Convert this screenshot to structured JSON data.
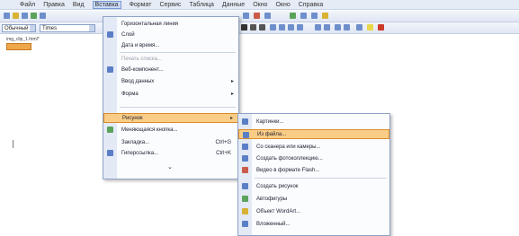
{
  "menubar": {
    "items": [
      {
        "label": "Файл",
        "active": false
      },
      {
        "label": "Правка",
        "active": false
      },
      {
        "label": "Вид",
        "active": false
      },
      {
        "label": "Вставка",
        "active": true
      },
      {
        "label": "Формат",
        "active": false
      },
      {
        "label": "Сервис",
        "active": false
      },
      {
        "label": "Таблица",
        "active": false
      },
      {
        "label": "Данные",
        "active": false
      },
      {
        "label": "Окно",
        "active": false
      },
      {
        "label": "Окно",
        "active": false
      },
      {
        "label": "Справка",
        "active": false
      }
    ]
  },
  "toolbar2": {
    "style_value": "Обычный",
    "font_value": "Times"
  },
  "document": {
    "filename": "img_clip_1.html*"
  },
  "insert_menu": {
    "items": [
      {
        "label": "Горизонтальная линия"
      },
      {
        "label": "Слой"
      },
      {
        "label": "Дата и время..."
      },
      {
        "label": "Печать списка..."
      },
      {
        "label": "Веб-компонент..."
      },
      {
        "label": "Ввод данных"
      },
      {
        "label": "Форма"
      },
      {
        "label": "Рисунок"
      },
      {
        "label": "Меняющаяся кнопка..."
      },
      {
        "label": "Закладка...",
        "shortcut": "Ctrl+G"
      },
      {
        "label": "Гиперссылка...",
        "shortcut": "Ctrl+K"
      }
    ]
  },
  "picture_submenu": {
    "items": [
      {
        "label": "Картинки..."
      },
      {
        "label": "Из файла..."
      },
      {
        "label": "Со сканера или камеры..."
      },
      {
        "label": "Создать фотоколлекцию..."
      },
      {
        "label": "Видео в формате Flash..."
      },
      {
        "label": "Создать рисунок"
      },
      {
        "label": "Автофигуры"
      },
      {
        "label": "Объект WordArt..."
      },
      {
        "label": "Вложенный..."
      }
    ]
  },
  "colors": {
    "accent_highlight": "#f9cd87",
    "menu_gutter": "#e3eaf6",
    "menubar_bg": "#e6ecf6"
  }
}
